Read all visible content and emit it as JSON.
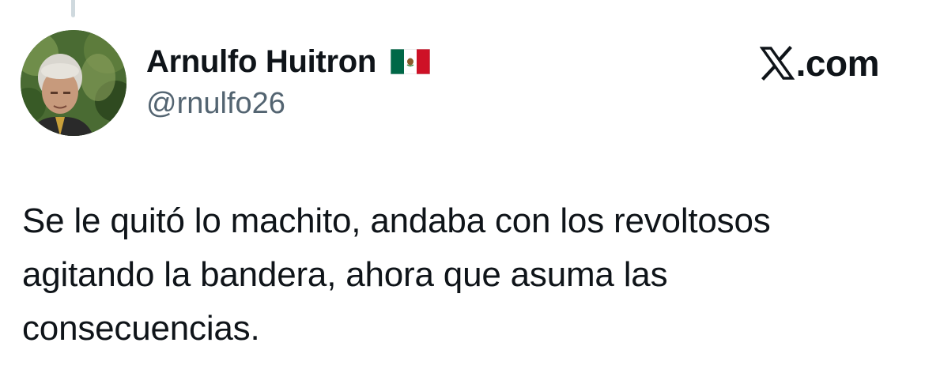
{
  "author": {
    "display_name": "Arnulfo Huitron",
    "handle": "@rnulfo26",
    "flag_icon": "mexico-flag-icon",
    "avatar_icon": "profile-photo"
  },
  "watermark": {
    "logo_icon": "x-logo-icon",
    "text": ".com"
  },
  "tweet": {
    "text": "Se le quitó lo machito, andaba con los revoltosos\nagitando la bandera, ahora que asuma las\nconsecuencias."
  },
  "colors": {
    "text_primary": "#0f1419",
    "text_secondary": "#536471",
    "thread_line": "#cfd9de",
    "background": "#ffffff"
  }
}
